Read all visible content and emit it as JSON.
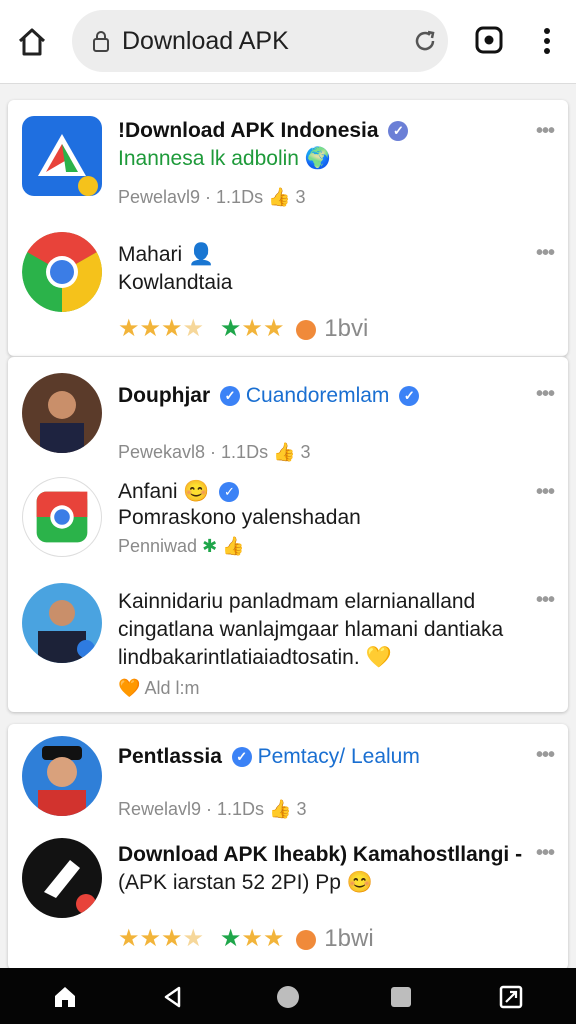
{
  "browser": {
    "url": "Download APK"
  },
  "feed": [
    {
      "title": "!Download APK Indonesia",
      "sub": "Inannesa lk adbolin",
      "meta": "Pewelavl9 · 1.1Ds",
      "count": "3"
    },
    {
      "title": "Mahari",
      "sub": "Kowlandtaia",
      "rating_label": "1bvi"
    },
    {
      "title": "Douphjar",
      "channel": "Cuandoremlam",
      "meta": "Pewekavl8 · 1.1Ds",
      "count": "3"
    },
    {
      "title": "Anfani",
      "sub": "Pomraskono yalenshadan",
      "meta": "Penniwad"
    },
    {
      "text1": "Kainnidariu panladmam elarnianalland",
      "text2": "cingatlana wanlajmgaar hlamani dantiaka",
      "text3": "lindbakarintlatiaiadtosatin.",
      "meta": "Ald l:m"
    },
    {
      "title": "Pentlassia",
      "channel": "Pemtacy/ Lealum",
      "meta": "Rewelavl9 · 1.1Ds",
      "count": "3"
    },
    {
      "title": "Download APK lheabk) Kamahostllangi -",
      "sub": "(APK iarstan 52 2PI) Pp",
      "rating_label": "1bwi"
    }
  ],
  "colors": {
    "accent_blue": "#1a6fd1",
    "accent_green": "#1e9a3a",
    "star_gold": "#f2b43a"
  },
  "icons": [
    "home-icon",
    "lock-icon",
    "reload-icon",
    "tabs-icon",
    "menu-icon",
    "back-icon",
    "recents-icon",
    "screenshot-icon"
  ]
}
